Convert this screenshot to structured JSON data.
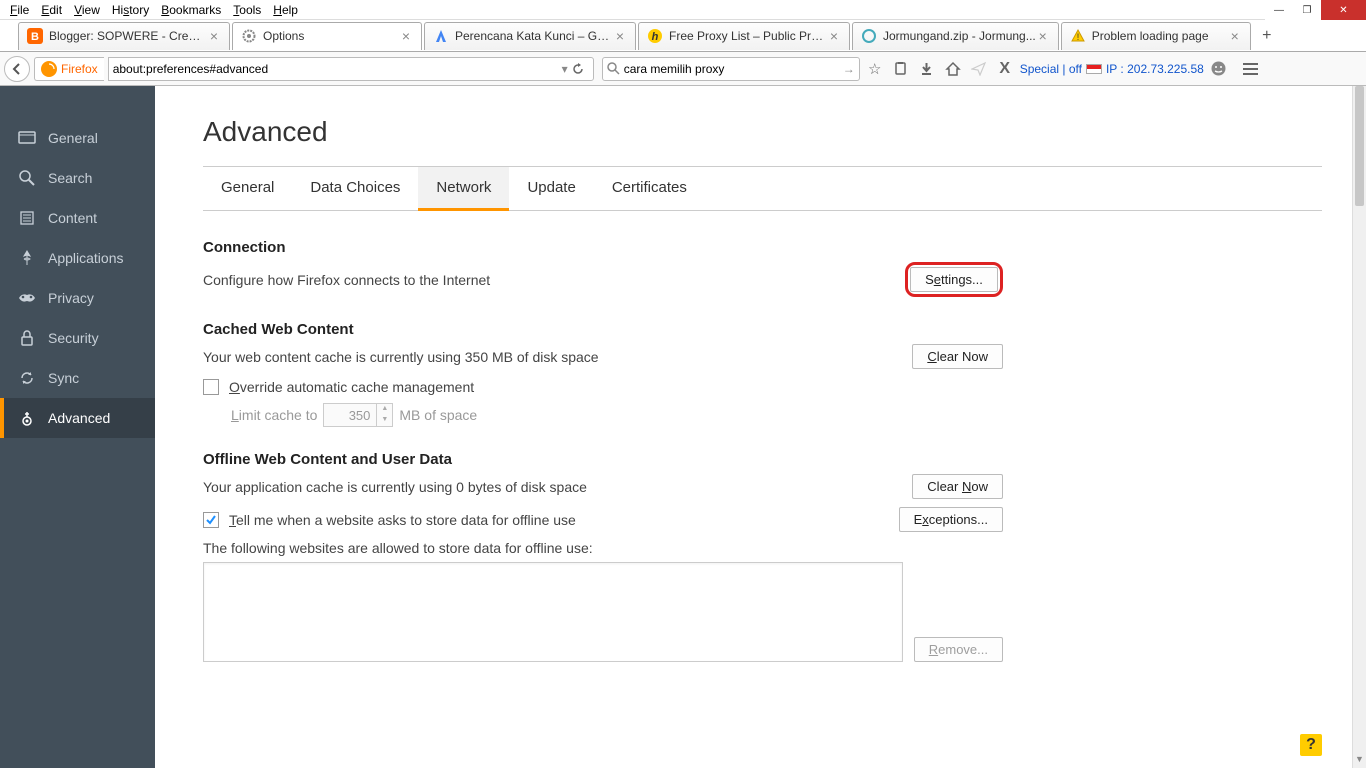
{
  "menubar": [
    "File",
    "Edit",
    "View",
    "History",
    "Bookmarks",
    "Tools",
    "Help"
  ],
  "tabs": [
    {
      "label": "Blogger: SOPWERE - Creat...",
      "icon": "blogger"
    },
    {
      "label": "Options",
      "icon": "gear",
      "active": true
    },
    {
      "label": "Perencana Kata Kunci – Go...",
      "icon": "adwords"
    },
    {
      "label": "Free Proxy List – Public Pro...",
      "icon": "hide"
    },
    {
      "label": "Jormungand.zip - Jormung...",
      "icon": "generic"
    },
    {
      "label": "Problem loading page",
      "icon": "warning"
    }
  ],
  "firefox_label": "Firefox",
  "url": "about:preferences#advanced",
  "search_value": "cara memilih proxy",
  "special_label": "Special | off",
  "ip_label": "IP : 202.73.225.58",
  "sidebar": [
    {
      "id": "general",
      "label": "General"
    },
    {
      "id": "search",
      "label": "Search"
    },
    {
      "id": "content",
      "label": "Content"
    },
    {
      "id": "applications",
      "label": "Applications"
    },
    {
      "id": "privacy",
      "label": "Privacy"
    },
    {
      "id": "security",
      "label": "Security"
    },
    {
      "id": "sync",
      "label": "Sync"
    },
    {
      "id": "advanced",
      "label": "Advanced",
      "active": true
    }
  ],
  "page_title": "Advanced",
  "subtabs": [
    "General",
    "Data Choices",
    "Network",
    "Update",
    "Certificates"
  ],
  "subtab_active": "Network",
  "connection": {
    "heading": "Connection",
    "desc": "Configure how Firefox connects to the Internet",
    "button": "Settings..."
  },
  "cached": {
    "heading": "Cached Web Content",
    "desc": "Your web content cache is currently using 350 MB of disk space",
    "clear": "Clear Now",
    "override": "Override automatic cache management",
    "limit_prefix": "Limit cache to",
    "limit_value": "350",
    "limit_suffix": "MB of space"
  },
  "offline": {
    "heading": "Offline Web Content and User Data",
    "desc": "Your application cache is currently using 0 bytes of disk space",
    "clear": "Clear Now",
    "tellme": "Tell me when a website asks to store data for offline use",
    "exceptions": "Exceptions...",
    "following": "The following websites are allowed to store data for offline use:",
    "remove": "Remove..."
  }
}
